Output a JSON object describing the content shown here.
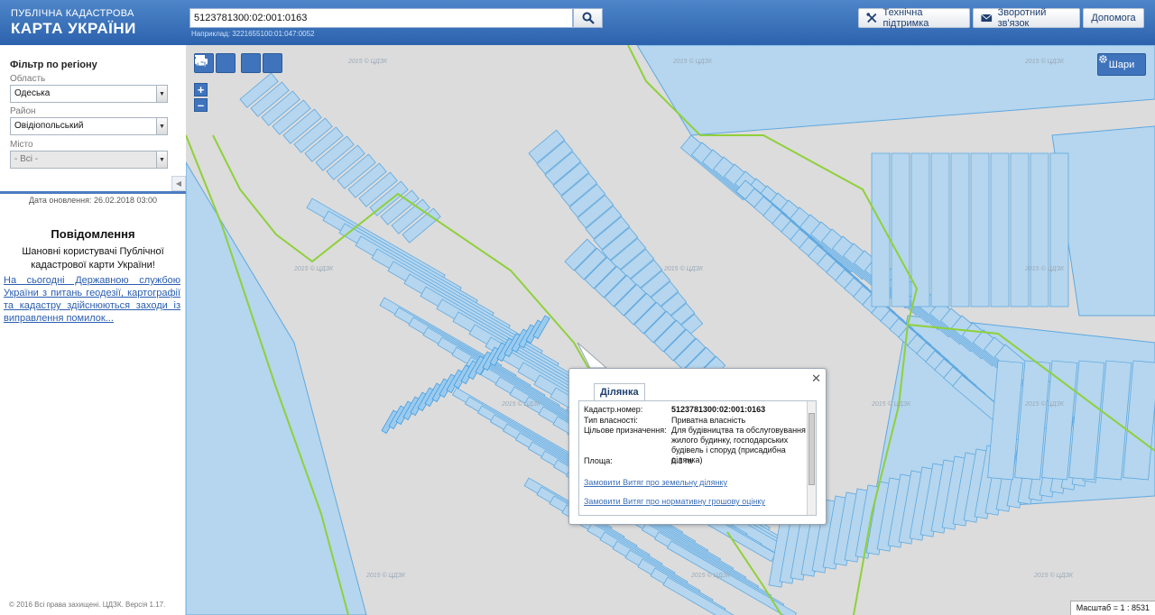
{
  "header": {
    "logo_line1": "ПУБЛІЧНА КАДАСТРОВА",
    "logo_line2": "КАРТА УКРАЇНИ",
    "search_value": "5123781300:02:001:0163",
    "search_example": "Наприклад: 3221655100:01:047:0052",
    "buttons": {
      "support": "Технічна підтримка",
      "feedback": "Зворотний зв'язок",
      "help": "Допомога"
    }
  },
  "sidebar": {
    "filter_title": "Фільтр по регіону",
    "region_label": "Область",
    "region_value": "Одеська",
    "district_label": "Район",
    "district_value": "Овідіопольський",
    "city_label": "Місто",
    "city_value": "- Всі -",
    "update_date": "Дата оновлення: 26.02.2018 03:00",
    "notice_title": "Повідомлення",
    "notice_text": "Шановні користувачі Публічної кадастрової карти України!",
    "notice_link": "На сьогодні Державною службою України з питань геодезії, картографії та кадастру здійснюються заходи із виправлення помилок...",
    "copyright": "© 2016 Всі права захищені. ЦДЗК. Версія 1.17."
  },
  "map": {
    "layers_label": "Шари",
    "zoom_in": "+",
    "zoom_out": "–",
    "scale_text": "Масштаб = 1 : 8531",
    "watermark": "2015 © ЦДЗК"
  },
  "popup": {
    "tab_label": "Ділянка",
    "fields": [
      {
        "key": "Кадастр.номер:",
        "value": "5123781300:02:001:0163"
      },
      {
        "key": "Тип власності:",
        "value": "Приватна власність"
      },
      {
        "key": "Цільове призначення:",
        "value": "Для будівництва та обслуговування жилого будинку, господарських будівель і споруд (присадибна ділянка)"
      },
      {
        "key": "Площа:",
        "value": "0.1 га"
      }
    ],
    "link_extract": "Замовити Витяг про земельну ділянку",
    "link_valuation": "Замовити Витяг про нормативну грошову оцінку"
  },
  "colors": {
    "header_blue": "#2c62ad",
    "parcel_fill": "#b5d6ee",
    "parcel_stroke": "#5fa8e0",
    "boundary": "#8fd03a",
    "road": "#dcdcdc"
  }
}
